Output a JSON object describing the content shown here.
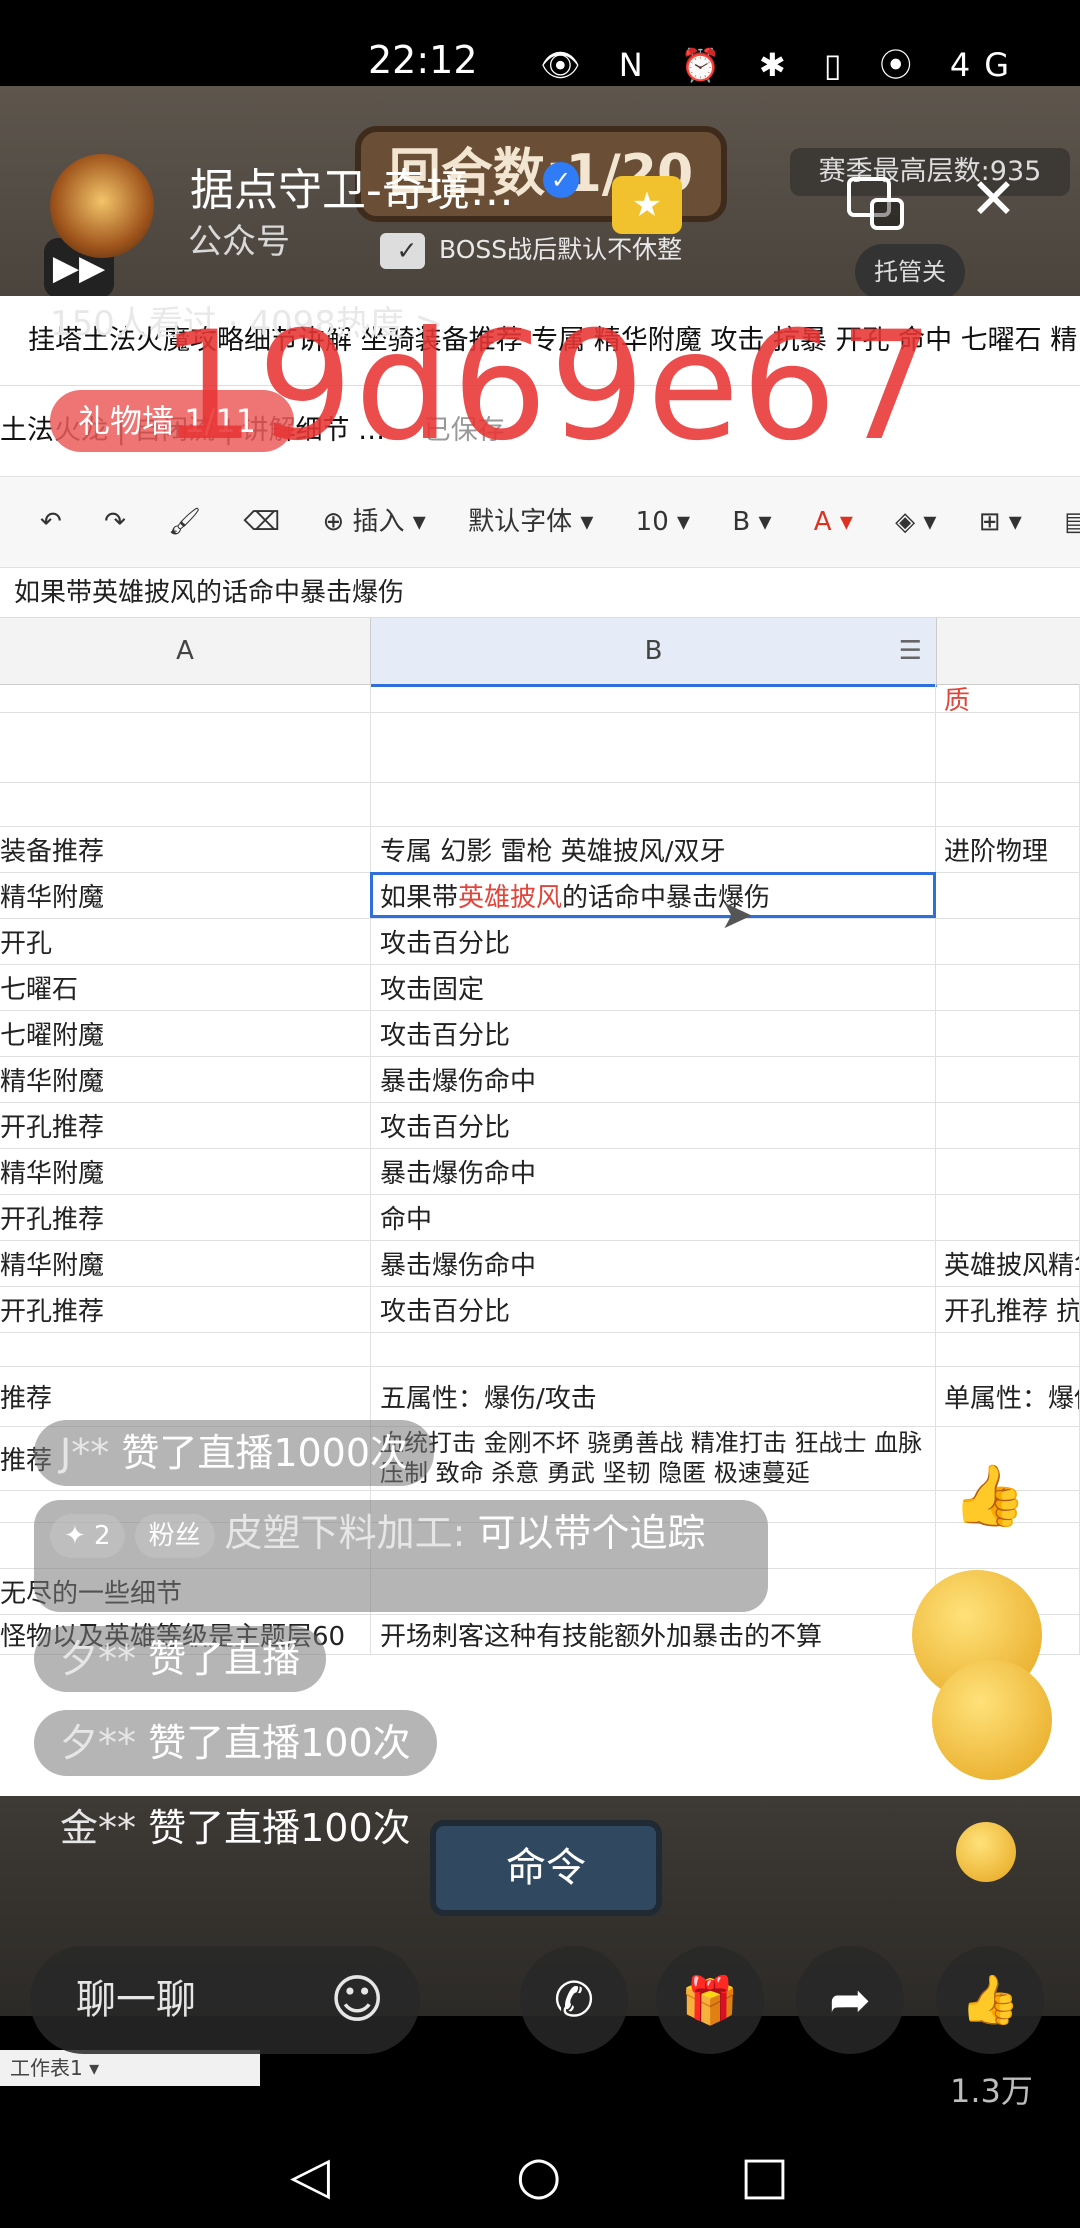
{
  "status_bar": {
    "time": "22:12",
    "icons": "👁 N ⏰ ✱ ▯ ⦿ 4G 5G ▭"
  },
  "game": {
    "round_counter": "回合数:1/20",
    "season_best": "赛季最高层数:935",
    "boss_checkbox": "BOSS战后默认不休整",
    "auto_button": "托管关",
    "command_button": "命令"
  },
  "channel": {
    "name": "据点守卫-奇境…",
    "subtitle": "公众号",
    "views": "150人看过 · 4098热度 >",
    "gifts": "礼物墙 1/11"
  },
  "overlay": {
    "watermark": "19d69e67"
  },
  "sheet": {
    "doc_tabs": "挂塔土法火魔攻略细节讲解 坐骑装备推荐 专属 精华附魔 攻击 抗暴 开孔 命中 七曜石 精",
    "title": "土法火龙 | 自闭流 | 讲解细节 …",
    "save_status": "已保存",
    "toolbar": {
      "undo": "↶",
      "redo": "↷",
      "format_painter": "🖌",
      "clear": "⌫",
      "insert": "⊕ 插入 ▾",
      "font": "默认字体 ▾",
      "size": "10 ▾",
      "bold": "B ▾",
      "font_color": "A ▾",
      "fill": "◈ ▾",
      "border": "⊞ ▾",
      "more": "▤ ▾"
    },
    "formula_text": "如果带英雄披风的话命中暴击爆伤",
    "columns": [
      "A",
      "B"
    ],
    "rows": [
      {
        "a": "",
        "b": "",
        "c": "质"
      },
      {
        "a": "",
        "b": "",
        "c": ""
      },
      {
        "a": "",
        "b": "",
        "c": ""
      },
      {
        "a": "装备推荐",
        "b": "专属 幻影 雷枪 英雄披风/双牙",
        "c": "进阶物理"
      },
      {
        "a": "精华附魔",
        "b_prefix": "如果带",
        "b_red": "英雄披风",
        "b_suffix": "的话命中暴击爆伤",
        "c": ""
      },
      {
        "a": "开孔",
        "b": "攻击百分比",
        "c": ""
      },
      {
        "a": "七曜石",
        "b": "攻击固定",
        "c": ""
      },
      {
        "a": "七曜附魔",
        "b": "攻击百分比",
        "c": ""
      },
      {
        "a": "精华附魔",
        "b": "暴击爆伤命中",
        "c": ""
      },
      {
        "a": "开孔推荐",
        "b": "攻击百分比",
        "c": ""
      },
      {
        "a": "精华附魔",
        "b": "暴击爆伤命中",
        "c": ""
      },
      {
        "a": "开孔推荐",
        "b": "命中",
        "c": ""
      },
      {
        "a": "精华附魔",
        "b": "暴击爆伤命中",
        "c": "英雄披风精华"
      },
      {
        "a": "开孔推荐",
        "b": "攻击百分比",
        "c": "开孔推荐 抗"
      },
      {
        "a": "",
        "b": "",
        "c": ""
      },
      {
        "a": "推荐",
        "b": "五属性：爆伤/攻击",
        "c": "单属性：爆伤"
      },
      {
        "a": "推荐",
        "b": "血统打击 金刚不坏 骁勇善战 精准打击 狂战士 血脉压制 致命 杀意 勇武 坚韧 隐匿 极速蔓延",
        "c": ""
      },
      {
        "a": "",
        "b": "",
        "c": ""
      },
      {
        "a": "",
        "b": "",
        "c": ""
      },
      {
        "a": "无尽的一些细节",
        "b": "",
        "c": ""
      },
      {
        "a": "怪物以及英雄等级是主题层60",
        "b": "开场刺客这种有技能额外加暴击的不算",
        "c": ""
      }
    ],
    "sheet_tab": "工作表1 ▾"
  },
  "chat": [
    {
      "user": "J**",
      "text": "赞了直播1000次"
    },
    {
      "user": "夕**",
      "text": "赞了直播"
    },
    {
      "user": "夕**",
      "text": "赞了直播100次"
    },
    {
      "user": "金**",
      "text": "赞了直播100次"
    }
  ],
  "fan_message": {
    "level": "✦ 2",
    "badge": "粉丝",
    "user": "皮塑下料加工:",
    "text": "可以带个追踪"
  },
  "actions": {
    "chat_label": "聊一聊",
    "emoji": "☺",
    "call": "✆",
    "gift": "🎁",
    "share": "➦",
    "like": "👍",
    "like_count": "1.3万"
  },
  "nav": {
    "back": "◁",
    "home": "○",
    "recent": "□"
  },
  "colors": {
    "watermark": "#e83434",
    "selection": "#2f6fdc",
    "red_text": "#e0463c",
    "verify": "#2f7cf6"
  }
}
